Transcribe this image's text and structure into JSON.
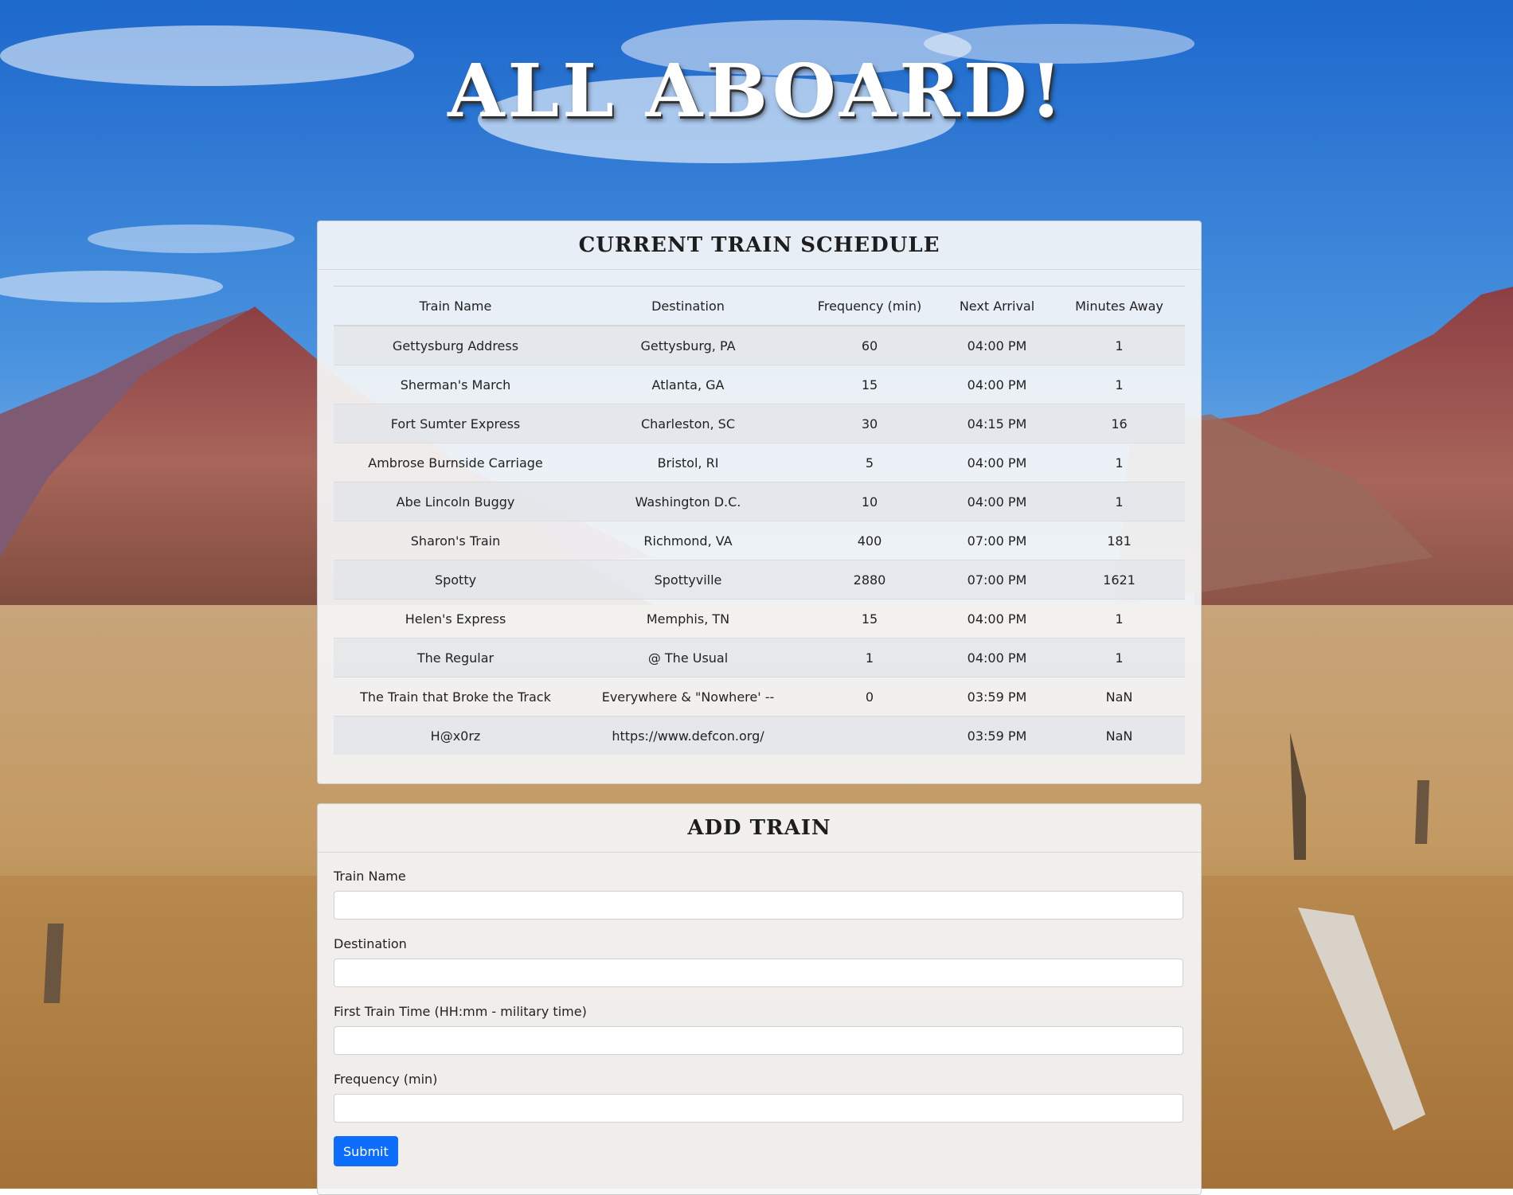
{
  "header": {
    "title": "ALL ABOARD!"
  },
  "schedule": {
    "heading": "CURRENT TRAIN SCHEDULE",
    "columns": [
      "Train Name",
      "Destination",
      "Frequency (min)",
      "Next Arrival",
      "Minutes Away"
    ],
    "rows": [
      [
        "Gettysburg Address",
        "Gettysburg, PA",
        "60",
        "04:00 PM",
        "1"
      ],
      [
        "Sherman's March",
        "Atlanta, GA",
        "15",
        "04:00 PM",
        "1"
      ],
      [
        "Fort Sumter Express",
        "Charleston, SC",
        "30",
        "04:15 PM",
        "16"
      ],
      [
        "Ambrose Burnside Carriage",
        "Bristol, RI",
        "5",
        "04:00 PM",
        "1"
      ],
      [
        "Abe Lincoln Buggy",
        "Washington D.C.",
        "10",
        "04:00 PM",
        "1"
      ],
      [
        "Sharon's Train",
        "Richmond, VA",
        "400",
        "07:00 PM",
        "181"
      ],
      [
        "Spotty",
        "Spottyville",
        "2880",
        "07:00 PM",
        "1621"
      ],
      [
        "Helen's Express",
        "Memphis, TN",
        "15",
        "04:00 PM",
        "1"
      ],
      [
        "The Regular",
        "@ The Usual",
        "1",
        "04:00 PM",
        "1"
      ],
      [
        "The Train that Broke the Track",
        "Everywhere & \"Nowhere' --",
        "0",
        "03:59 PM",
        "NaN"
      ],
      [
        "H@x0rz",
        "https://www.defcon.org/",
        "",
        "03:59 PM",
        "NaN"
      ]
    ]
  },
  "add_train": {
    "heading": "ADD TRAIN",
    "fields": [
      {
        "label": "Train Name",
        "value": ""
      },
      {
        "label": "Destination",
        "value": ""
      },
      {
        "label": "First Train Time (HH:mm - military time)",
        "value": ""
      },
      {
        "label": "Frequency (min)",
        "value": ""
      }
    ],
    "submit_label": "Submit"
  },
  "colors": {
    "accent": "#0d6efd",
    "panel": "#f5f6f8"
  }
}
